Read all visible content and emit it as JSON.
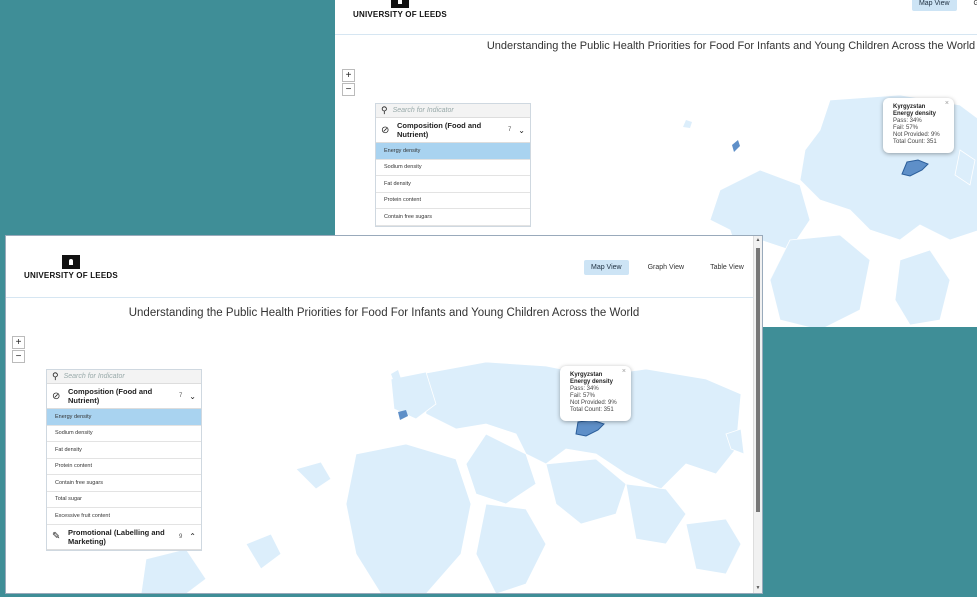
{
  "header": {
    "logo_text": "UNIVERSITY OF LEEDS",
    "nav": [
      {
        "label": "Map View",
        "active": true
      },
      {
        "label": "Graph View",
        "active": false
      },
      {
        "label": "Table View",
        "active": false
      }
    ]
  },
  "page_title": "Understanding the Public Health Priorities for Food For Infants and Young Children Across the World",
  "zoom": {
    "in": "+",
    "out": "−"
  },
  "panel": {
    "search_placeholder": "Search for Indicator",
    "groups": [
      {
        "label": "Composition (Food and Nutrient)",
        "count": "7",
        "expanded": true,
        "icon": "nutrient-icon",
        "items": [
          {
            "label": "Energy density",
            "active": true
          },
          {
            "label": "Sodium density",
            "active": false
          },
          {
            "label": "Fat density",
            "active": false
          },
          {
            "label": "Protein content",
            "active": false
          },
          {
            "label": "Contain free sugars",
            "active": false
          },
          {
            "label": "Total sugar",
            "active": false
          },
          {
            "label": "Excessive fruit content",
            "active": false
          }
        ]
      },
      {
        "label": "Promotional (Labelling and Marketing)",
        "count": "9",
        "expanded": false,
        "icon": "tag-icon"
      }
    ]
  },
  "tooltip": {
    "country": "Kyrgyzstan",
    "indicator": "Energy density",
    "pass": "Pass: 34%",
    "fail": "Fail: 57%",
    "not_provided": "Not Provided: 9%",
    "total": "Total Count: 351",
    "close": "×"
  },
  "colors": {
    "background": "#3f8e97",
    "land": "#dceefb",
    "highlight": "#5e8fc8",
    "active_item": "#a9d3f0",
    "active_tab": "#cde4f5"
  }
}
